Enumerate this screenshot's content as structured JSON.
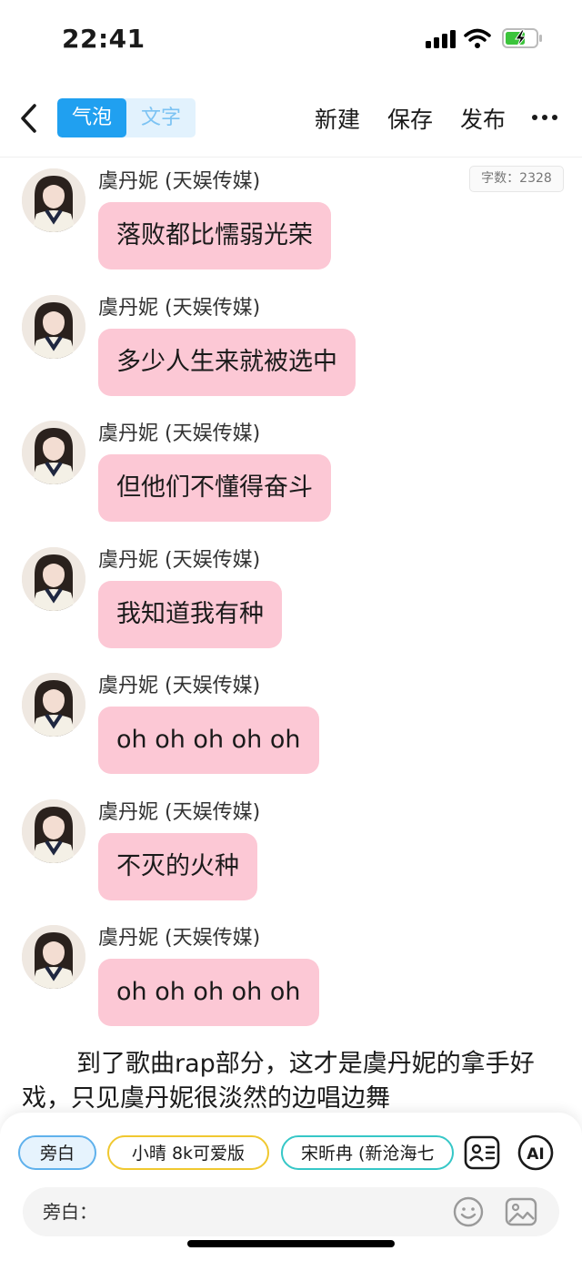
{
  "status": {
    "time": "22:41"
  },
  "nav": {
    "tabs": [
      "气泡",
      "文字"
    ],
    "new_label": "新建",
    "save_label": "保存",
    "publish_label": "发布"
  },
  "word_count": "字数：2328",
  "messages": [
    {
      "author": "虞丹妮 (天娱传媒)",
      "text": "落败都比懦弱光荣"
    },
    {
      "author": "虞丹妮 (天娱传媒)",
      "text": "多少人生来就被选中"
    },
    {
      "author": "虞丹妮 (天娱传媒)",
      "text": "但他们不懂得奋斗"
    },
    {
      "author": "虞丹妮 (天娱传媒)",
      "text": "我知道我有种"
    },
    {
      "author": "虞丹妮 (天娱传媒)",
      "text": "oh oh oh oh oh"
    },
    {
      "author": "虞丹妮 (天娱传媒)",
      "text": "不灭的火种"
    },
    {
      "author": "虞丹妮 (天娱传媒)",
      "text": "oh oh oh oh oh"
    }
  ],
  "narration": "到了歌曲rap部分，这才是虞丹妮的拿手好戏，只见虞丹妮很淡然的边唱边舞",
  "characters": [
    "旁白",
    "小晴 8k可爱版",
    "宋昕冉 (新沧海七"
  ],
  "input": {
    "label": "旁白："
  },
  "colors": {
    "accent": "#20a0f0",
    "bubble": "#fcc8d5"
  }
}
